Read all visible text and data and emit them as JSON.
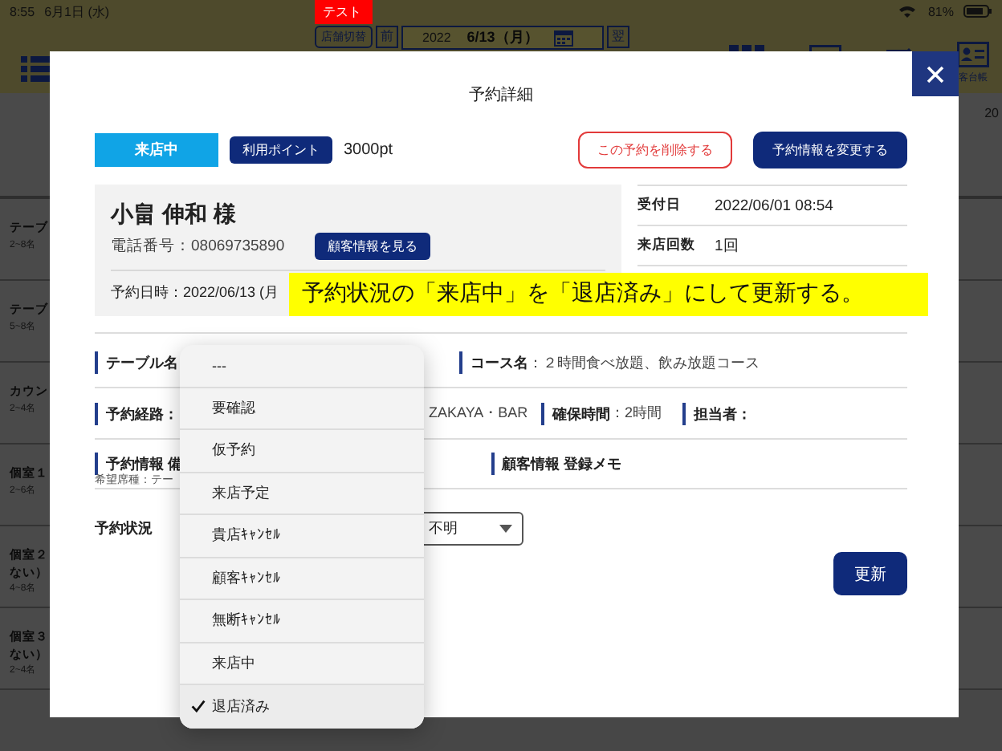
{
  "status_bar": {
    "time": "8:55",
    "date": "6月1日 (水)",
    "battery": "81%"
  },
  "header": {
    "env_badge": "テスト",
    "store_switch": "店舗切替",
    "prev_day": "前",
    "year": "2022",
    "date": "6/13（月）",
    "next_day": "翌",
    "ledger_label": "客台帳"
  },
  "schedule": {
    "date_header": "20",
    "rows": [
      {
        "lines": [
          "テーブ"
        ],
        "capacity": "2~8名"
      },
      {
        "lines": [
          "テーブ"
        ],
        "capacity": "5~8名"
      },
      {
        "lines": [
          "カウン"
        ],
        "capacity": "2~4名"
      },
      {
        "lines": [
          "個室１"
        ],
        "capacity": "2~6名"
      },
      {
        "lines": [
          "個室２",
          "ない）"
        ],
        "capacity": "4~8名"
      },
      {
        "lines": [
          "個室３",
          "ない）"
        ],
        "capacity": "2~4名"
      }
    ]
  },
  "modal": {
    "title": "予約詳細",
    "status": "来店中",
    "points_label": "利用ポイント",
    "points": "3000pt",
    "delete_button": "この予約を削除する",
    "edit_button": "予約情報を変更する",
    "customer": {
      "name": "小畠 伸和 様",
      "phone": "電話番号：08069735890",
      "view_button": "顧客情報を見る",
      "datetime": "予約日時：2022/06/13 (月"
    },
    "info_rows": [
      {
        "label": "受付日",
        "value": "2022/06/01 08:54"
      },
      {
        "label": "来店回数",
        "value": "1回"
      }
    ],
    "table_label": "テーブル名",
    "course_label": "コース名",
    "course_value": "：２時間食べ放題、飲み放題コース",
    "route_label": "予約経路：",
    "route_value": "ZAKAYA・BAR",
    "hold_label": "確保時間",
    "hold_value": "：2時間",
    "staff_label": "担当者：",
    "booking_section": "予約情報 備",
    "customer_section": "顧客情報 登録メモ",
    "seat_note": "希望席種：テー",
    "status_label": "予約状況",
    "second_select": "不明",
    "update_button": "更新"
  },
  "dropdown": {
    "options": [
      {
        "label": "---",
        "selected": false
      },
      {
        "label": "要確認",
        "selected": false
      },
      {
        "label": "仮予約",
        "selected": false
      },
      {
        "label": "来店予定",
        "selected": false
      },
      {
        "label": "貴店ｷｬﾝｾﾙ",
        "selected": false
      },
      {
        "label": "顧客ｷｬﾝｾﾙ",
        "selected": false
      },
      {
        "label": "無断ｷｬﾝｾﾙ",
        "selected": false
      },
      {
        "label": "来店中",
        "selected": false
      },
      {
        "label": "退店済み",
        "selected": true
      }
    ]
  },
  "annotation": "予約状況の「来店中」を「退店済み」にして更新する。"
}
